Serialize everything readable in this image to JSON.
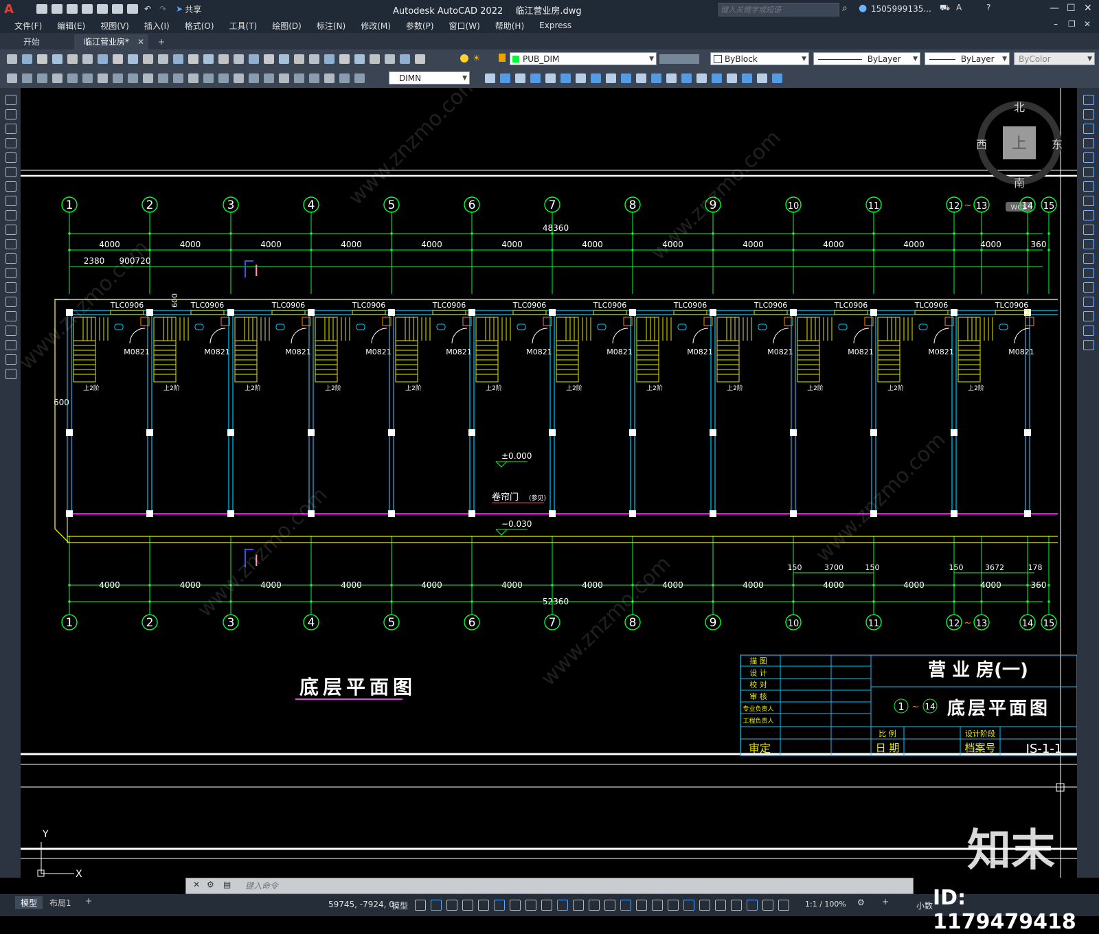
{
  "title_bar": {
    "app_title": "Autodesk AutoCAD 2022",
    "file_name": "临江营业房.dwg",
    "share": "共享",
    "search_placeholder": "键入关键字或短语",
    "user": "1505999135...",
    "app_logo": "A"
  },
  "menu": [
    "文件(F)",
    "编辑(E)",
    "视图(V)",
    "插入(I)",
    "格式(O)",
    "工具(T)",
    "绘图(D)",
    "标注(N)",
    "修改(M)",
    "参数(P)",
    "窗口(W)",
    "帮助(H)",
    "Express"
  ],
  "tabs": [
    {
      "label": "开始"
    },
    {
      "label": "临江营业房*"
    }
  ],
  "toolbar": {
    "layer": "PUB_DIM",
    "color": "ByBlock",
    "linetype": "ByLayer",
    "lineweight": "ByLayer",
    "plotstyle": "ByColor",
    "dimstyle": "DIMN"
  },
  "viewcube": {
    "north": "北",
    "south": "南",
    "east": "东",
    "west": "西",
    "face": "上",
    "wcs": "WCS"
  },
  "drawing": {
    "axes": [
      "1",
      "2",
      "3",
      "4",
      "5",
      "6",
      "7",
      "8",
      "9",
      "10",
      "11",
      "12",
      "13",
      "14",
      "15"
    ],
    "tilde": "~",
    "top_total": "48360",
    "bottom_total": "52360",
    "bay": "4000",
    "end_dim": "360",
    "sub_dims": [
      "2380",
      "900",
      "720"
    ],
    "dim_600": "600",
    "window_label": "TLC0906",
    "door_label": "M0821",
    "stair_label": "上2阶",
    "level_0": "±0.000",
    "level_1": "−0.030",
    "shutter_label": "卷帘门",
    "shutter_note": "(参见)",
    "section_mark": "I",
    "right_dims_a": [
      "150",
      "3700",
      "150"
    ],
    "right_dims_b": [
      "150",
      "3672",
      "178"
    ],
    "plan_title": "底层平面图",
    "ucs_y": "Y",
    "ucs_x": "X"
  },
  "title_block": {
    "roles": [
      "描  图",
      "设  计",
      "校  对",
      "审  核",
      "专业负责人",
      "工程负责人"
    ],
    "approve": "审定",
    "project": "营 业 房(一)",
    "range_a": "1",
    "range_b": "14",
    "sheet_title": "底层平面图",
    "scale_label": "比  例",
    "date_label": "日  期",
    "stage_label": "设计阶段",
    "archive_label": "档案号",
    "drawing_no": "JS-1-1"
  },
  "command": {
    "placeholder": "键入命令"
  },
  "layout_tabs": [
    "模型",
    "布局1"
  ],
  "status": {
    "coords": "59745, -7924, 0",
    "space": "模型",
    "scale": "1:1 / 100%",
    "units": "小数"
  },
  "watermark": {
    "brand": "知末",
    "id": "ID: 1179479418",
    "site": "www.znzmo.com"
  },
  "colors": {
    "green": "#00ff33",
    "yellow": "#e8e800",
    "cyan": "#00c8ff",
    "magenta": "#ff00ff"
  }
}
